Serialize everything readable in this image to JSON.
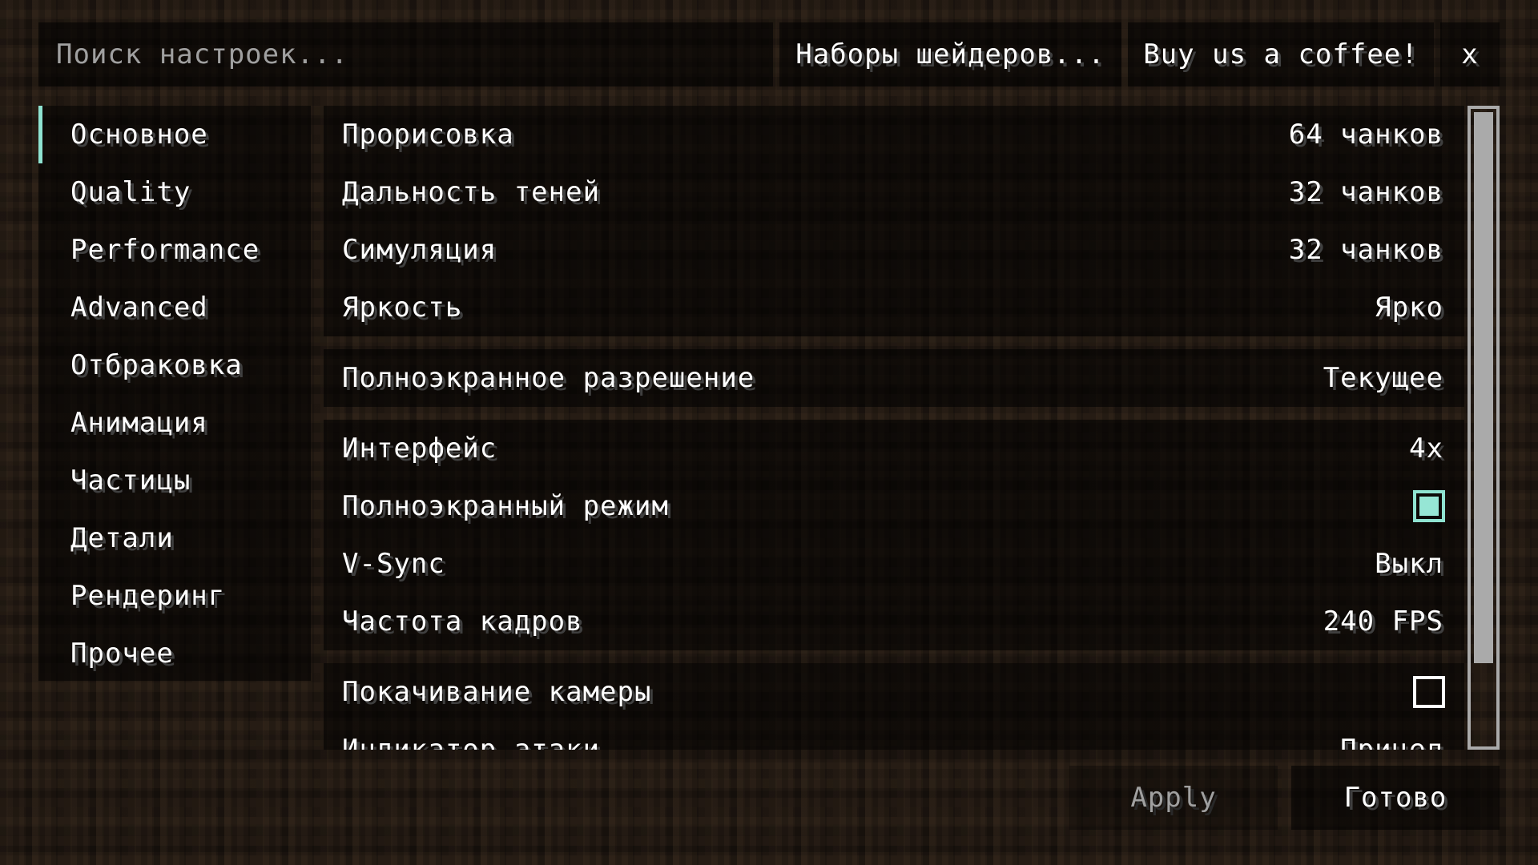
{
  "search": {
    "placeholder": "Поиск настроек...",
    "value": ""
  },
  "top_buttons": {
    "shader_packs": "Наборы шейдеров...",
    "coffee": "Buy us a coffee!",
    "close": "x"
  },
  "sidebar": {
    "items": [
      {
        "label": "Основное",
        "active": true
      },
      {
        "label": "Quality"
      },
      {
        "label": "Performance"
      },
      {
        "label": "Advanced"
      },
      {
        "label": "Отбраковка"
      },
      {
        "label": "Анимация"
      },
      {
        "label": "Частицы"
      },
      {
        "label": "Детали"
      },
      {
        "label": "Рендеринг"
      },
      {
        "label": "Прочее"
      }
    ]
  },
  "options": {
    "group1": [
      {
        "label": "Прорисовка",
        "value": "64 чанков"
      },
      {
        "label": "Дальность теней",
        "value": "32 чанков"
      },
      {
        "label": "Симуляция",
        "value": "32 чанков"
      },
      {
        "label": "Яркость",
        "value": "Ярко"
      }
    ],
    "group2": [
      {
        "label": "Полноэкранное разрешение",
        "value": "Текущее"
      }
    ],
    "group3": [
      {
        "label": "Интерфейс",
        "value": "4x"
      },
      {
        "label": "Полноэкранный режим",
        "checked": true
      },
      {
        "label": "V-Sync",
        "value": "Выкл"
      },
      {
        "label": "Частота кадров",
        "value": "240 FPS"
      }
    ],
    "group4": [
      {
        "label": "Покачивание камеры",
        "checked": false
      },
      {
        "label": "Индикатор атаки",
        "value": "Прицел"
      }
    ]
  },
  "scroll": {
    "position_fraction": 0.0,
    "visible_fraction": 0.86
  },
  "colors": {
    "accent": "#8fe3d1",
    "checkbox_fill": "#96e6d5",
    "scrollbar": "#aaaaaa"
  },
  "bottom_buttons": {
    "apply": "Apply",
    "apply_enabled": false,
    "done": "Готово"
  }
}
